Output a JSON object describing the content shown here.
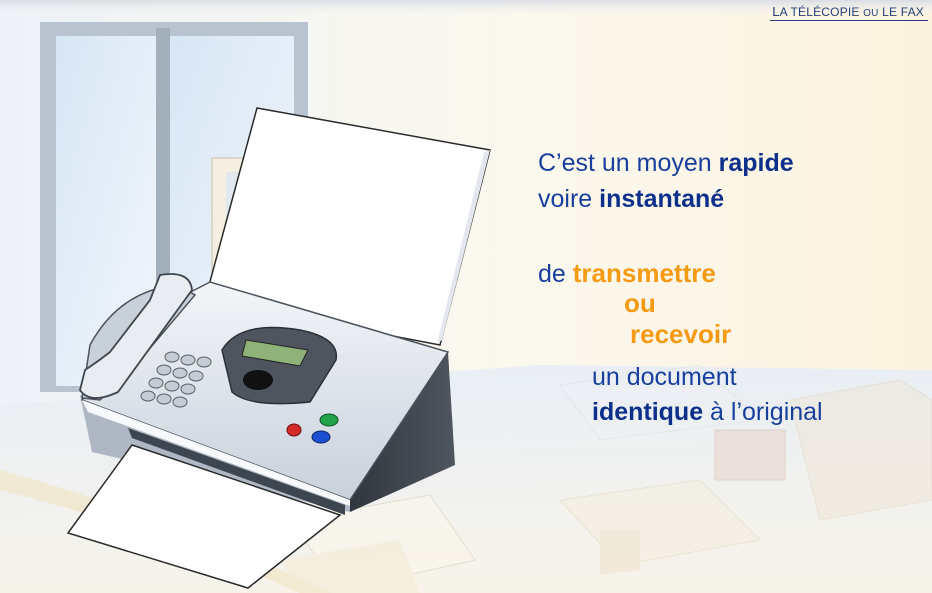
{
  "header": {
    "title_first_letter": "L",
    "title_rest": "A TÉLÉCOPIE ",
    "title_small": "OU",
    "title_end": " LE FAX"
  },
  "text": {
    "line1_pre": "C’est un moyen ",
    "line1_bold": "rapide",
    "line2_pre": "voire ",
    "line2_bold": "instantané",
    "line3_pre": "de ",
    "line3_orange": "transmettre",
    "line4_orange": "ou",
    "line5_orange": "recevoir",
    "line6": "un document",
    "line7_bold": "identique",
    "line7_post": " à l’original"
  },
  "fax_display": "",
  "colors": {
    "text_blue": "#173f9e",
    "bold_blue": "#0b2f8a",
    "orange": "#f59a12",
    "fax_body": "#dde3ec",
    "fax_dark": "#3a3f46",
    "display_green": "#8fb27a",
    "button_red": "#d12a2a",
    "button_green": "#22a34a",
    "button_blue": "#1a4fcf"
  }
}
